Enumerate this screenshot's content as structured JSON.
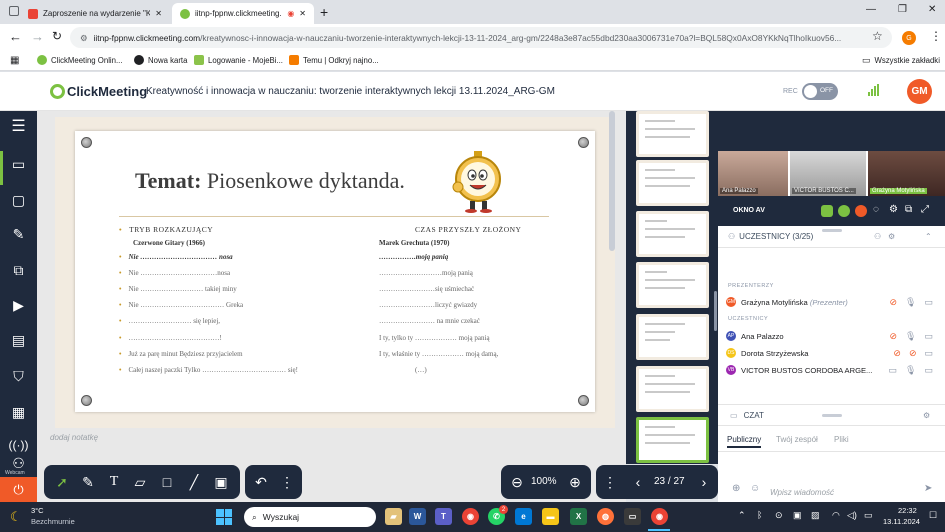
{
  "browser": {
    "tabs": [
      {
        "label": "Zaproszenie na wydarzenie \"Kre",
        "favicon_color": "#ea4335"
      },
      {
        "label": "iitnp-fppnw.clickmeeting.c",
        "favicon_color": "#5f6368"
      }
    ],
    "new_tab": "+",
    "url_domain": "iitnp-fppnw.clickmeeting.com",
    "url_path": "/kreatywnosc-i-innowacja-w-nauczaniu-tworzenie-interaktywnych-lekcji-13-11-2024_arg-gm/2248a3e87ac55dbd230aa3006731e70a?l=BQL58Qx0AxO8YKkNqTlhoIkuov56...",
    "bookmarks": [
      {
        "label": "ClickMeeting Onlin...",
        "color": "#7cc142"
      },
      {
        "label": "Nowa karta",
        "color": "#202124"
      },
      {
        "label": "Logowanie - MojeBi...",
        "color": "#8bc34a"
      },
      {
        "label": "Temu | Odkryj najno...",
        "color": "#f57c00"
      }
    ],
    "all_bookmarks": "Wszystkie zakładki",
    "profile_initial": "G"
  },
  "app": {
    "logo_text": "ClickMeeting",
    "meeting_title": "Kreatywność i innowacja w nauczaniu: tworzenie interaktywnych lekcji 13.11.2024_ARG-GM",
    "rec_label": "REC",
    "rec_toggle": "OFF",
    "user_initials": "GM",
    "accent": "#7cc142",
    "avatar_color": "#f05a28"
  },
  "sidebar": {
    "webcam_label": "Webcam"
  },
  "slide": {
    "title_bold": "Temat:",
    "title_rest": " Piosenkowe dyktanda.",
    "left_header": "TRYB ROZKAZUJĄCY",
    "left_song": "Czerwone Gitary (1966)",
    "left_lines": [
      "Nie …………………………… nosa",
      "Nie ……………………………nosa",
      "Nie ……………………… takiej miny",
      "Nie ……………………………… Greka",
      "……………………… się lepiej,",
      "…………………………………!",
      "Już za parę minut Będziesz przyjacielem",
      "Całej naszej paczki Tylko ……………………………… się!"
    ],
    "right_header": "CZAS PRZYSZŁY ZŁOŻONY",
    "right_song": "Marek Grechuta (1970)",
    "right_lines": [
      "…………….moją panią",
      "………………………moją panią",
      "……………………się uśmiechać",
      "……………………liczyć gwiazdy",
      "…………………… na mnie czekać",
      "I ty, tylko ty ……………… moją panią",
      "I ty, właśnie ty ……………… moją damą,",
      "(…)"
    ]
  },
  "stage": {
    "note_placeholder": "dodaj notatkę",
    "zoom": "100%",
    "page_counter": "23 / 27"
  },
  "right_panel": {
    "cams": [
      "Ana Palazzo",
      "VICTOR BUSTOS C...",
      "Grażyna Motylińska"
    ],
    "window_label": "OKNO AV",
    "participants_header": "UCZESTNICY (3/25)",
    "presenters_label": "PREZENTERZY",
    "presenter": {
      "name": "Grażyna Motylińska",
      "role": "(Prezenter)",
      "initials": "GM",
      "color": "#f05a28"
    },
    "attendees_label": "UCZESTNICY",
    "attendees": [
      {
        "name": "Ana Palazzo",
        "initials": "AP",
        "color": "#3f51b5"
      },
      {
        "name": "Dorota Strzyżewska",
        "initials": "DS",
        "color": "#f5c518"
      },
      {
        "name": "VICTOR BUSTOS CORDOBA ARGE...",
        "initials": "VB",
        "color": "#9c27b0"
      }
    ],
    "chat_header": "CZAT",
    "chat_tabs": [
      "Publiczny",
      "Twój zespół",
      "Pliki"
    ],
    "chat_placeholder": "Wpisz wiadomość"
  },
  "taskbar": {
    "weather_temp": "3°C",
    "weather_desc": "Bezchmurnie",
    "search_placeholder": "Wyszukaj",
    "time": "22:32",
    "date": "13.11.2024",
    "badge": "2"
  }
}
